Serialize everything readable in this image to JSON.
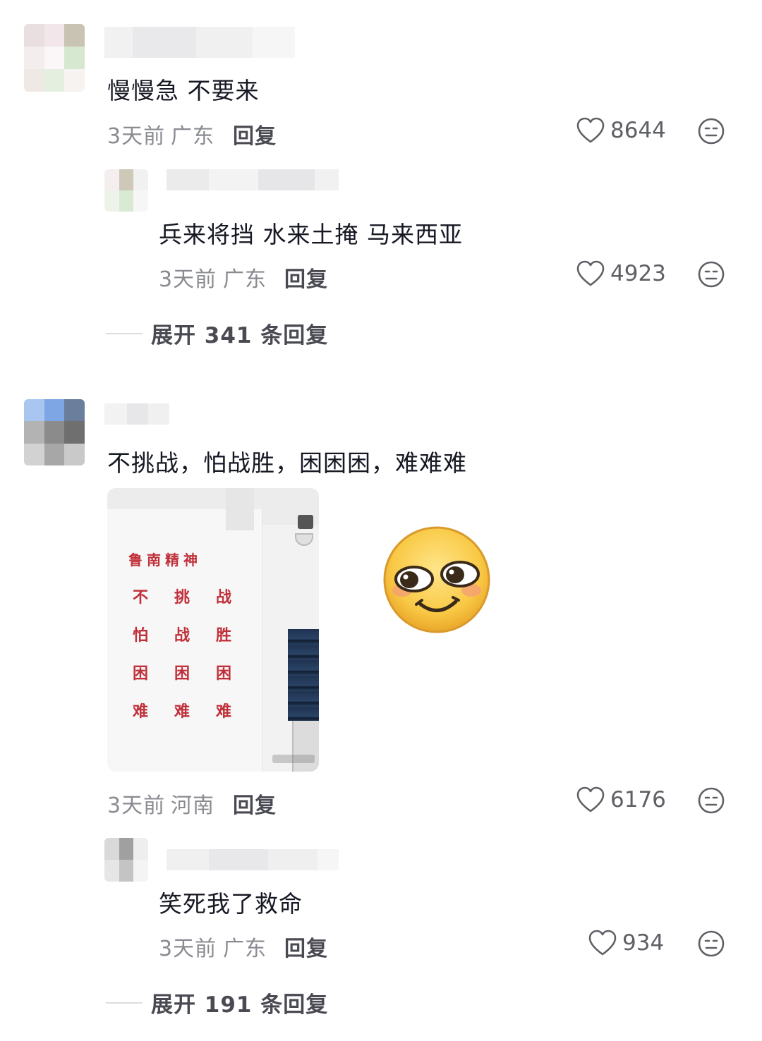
{
  "comments": [
    {
      "text": "慢慢急 不要来",
      "time": "3天前",
      "location": "广东",
      "reply_label": "回复",
      "likes": "8644",
      "replies": [
        {
          "text": "兵来将挡 水来土掩 马来西亚",
          "time": "3天前",
          "location": "广东",
          "reply_label": "回复",
          "likes": "4923"
        }
      ],
      "expand_label": "展开 341 条回复"
    },
    {
      "text": "不挑战，怕战胜，困困困，难难难",
      "image": {
        "sign_lines": [
          [
            "鲁",
            "南",
            "精",
            "神"
          ],
          [
            "不",
            "挑",
            "战"
          ],
          [
            "怕",
            "战",
            "胜"
          ],
          [
            "困",
            "困",
            "困"
          ],
          [
            "难",
            "难",
            "难"
          ]
        ]
      },
      "sticker": "smirk-emoji",
      "time": "3天前",
      "location": "河南",
      "reply_label": "回复",
      "likes": "6176",
      "replies": [
        {
          "text": "笑死我了救命",
          "time": "3天前",
          "location": "广东",
          "reply_label": "回复",
          "likes": "934"
        }
      ],
      "expand_label": "展开 191 条回复"
    }
  ],
  "icons": {
    "like": "heart-outline-icon",
    "dislike": "neutral-face-icon"
  },
  "colors": {
    "primary_text": "#161823",
    "meta_text": "#8a8b91",
    "sign_red": "#c0303a"
  }
}
